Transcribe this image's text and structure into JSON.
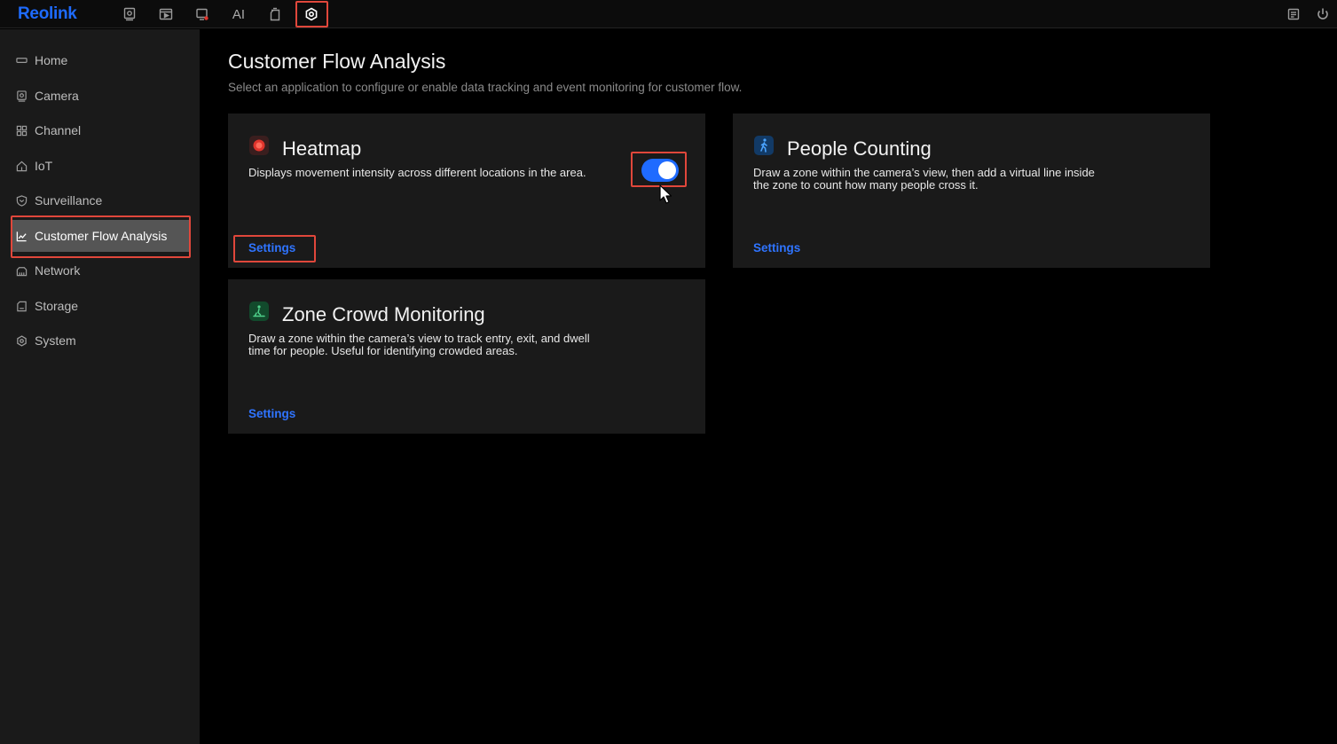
{
  "app": {
    "logo": "Reolink"
  },
  "topnav": {
    "items": [
      {
        "name": "live-view",
        "icon": "monitor-icon"
      },
      {
        "name": "playback",
        "icon": "playback-icon"
      },
      {
        "name": "alarm",
        "icon": "alarm-icon"
      },
      {
        "name": "ai",
        "label": "AI"
      },
      {
        "name": "files",
        "icon": "clipboard-icon"
      },
      {
        "name": "settings",
        "icon": "gear-icon",
        "active": true
      }
    ],
    "right": [
      {
        "name": "notes",
        "icon": "notes-icon"
      },
      {
        "name": "power",
        "icon": "power-icon"
      }
    ]
  },
  "sidebar": {
    "items": [
      {
        "label": "Home",
        "icon": "home-icon"
      },
      {
        "label": "Camera",
        "icon": "camera-icon"
      },
      {
        "label": "Channel",
        "icon": "grid-icon"
      },
      {
        "label": "IoT",
        "icon": "iot-icon"
      },
      {
        "label": "Surveillance",
        "icon": "shield-icon"
      },
      {
        "label": "Customer Flow Analysis",
        "icon": "chart-icon",
        "active": true
      },
      {
        "label": "Network",
        "icon": "network-icon"
      },
      {
        "label": "Storage",
        "icon": "storage-icon"
      },
      {
        "label": "System",
        "icon": "system-icon"
      }
    ]
  },
  "main": {
    "title": "Customer Flow Analysis",
    "subtitle": "Select an application to configure or enable data tracking and event monitoring for customer flow.",
    "cards": {
      "heatmap": {
        "title": "Heatmap",
        "description": "Displays movement intensity across different locations in the area.",
        "settings_label": "Settings",
        "toggle_on": true,
        "icon_color": "#e0342c"
      },
      "people_counting": {
        "title": "People Counting",
        "description_line1": "Draw a zone within the camera’s view, then add a virtual line inside",
        "description_line2": "the zone to count how many people cross it.",
        "settings_label": "Settings",
        "icon_color": "#1a6bd8"
      },
      "zone_crowd": {
        "title": "Zone Crowd Monitoring",
        "description_line1": "Draw a zone within the camera’s view to track entry, exit, and dwell",
        "description_line2": "time for people. Useful for identifying crowded areas.",
        "settings_label": "Settings",
        "icon_color": "#1f8a4c"
      }
    }
  },
  "colors": {
    "accent": "#1f6bff",
    "highlight_box": "#e0473b",
    "sidebar_bg": "#1a1a1a",
    "card_bg": "#1a1a1a"
  }
}
